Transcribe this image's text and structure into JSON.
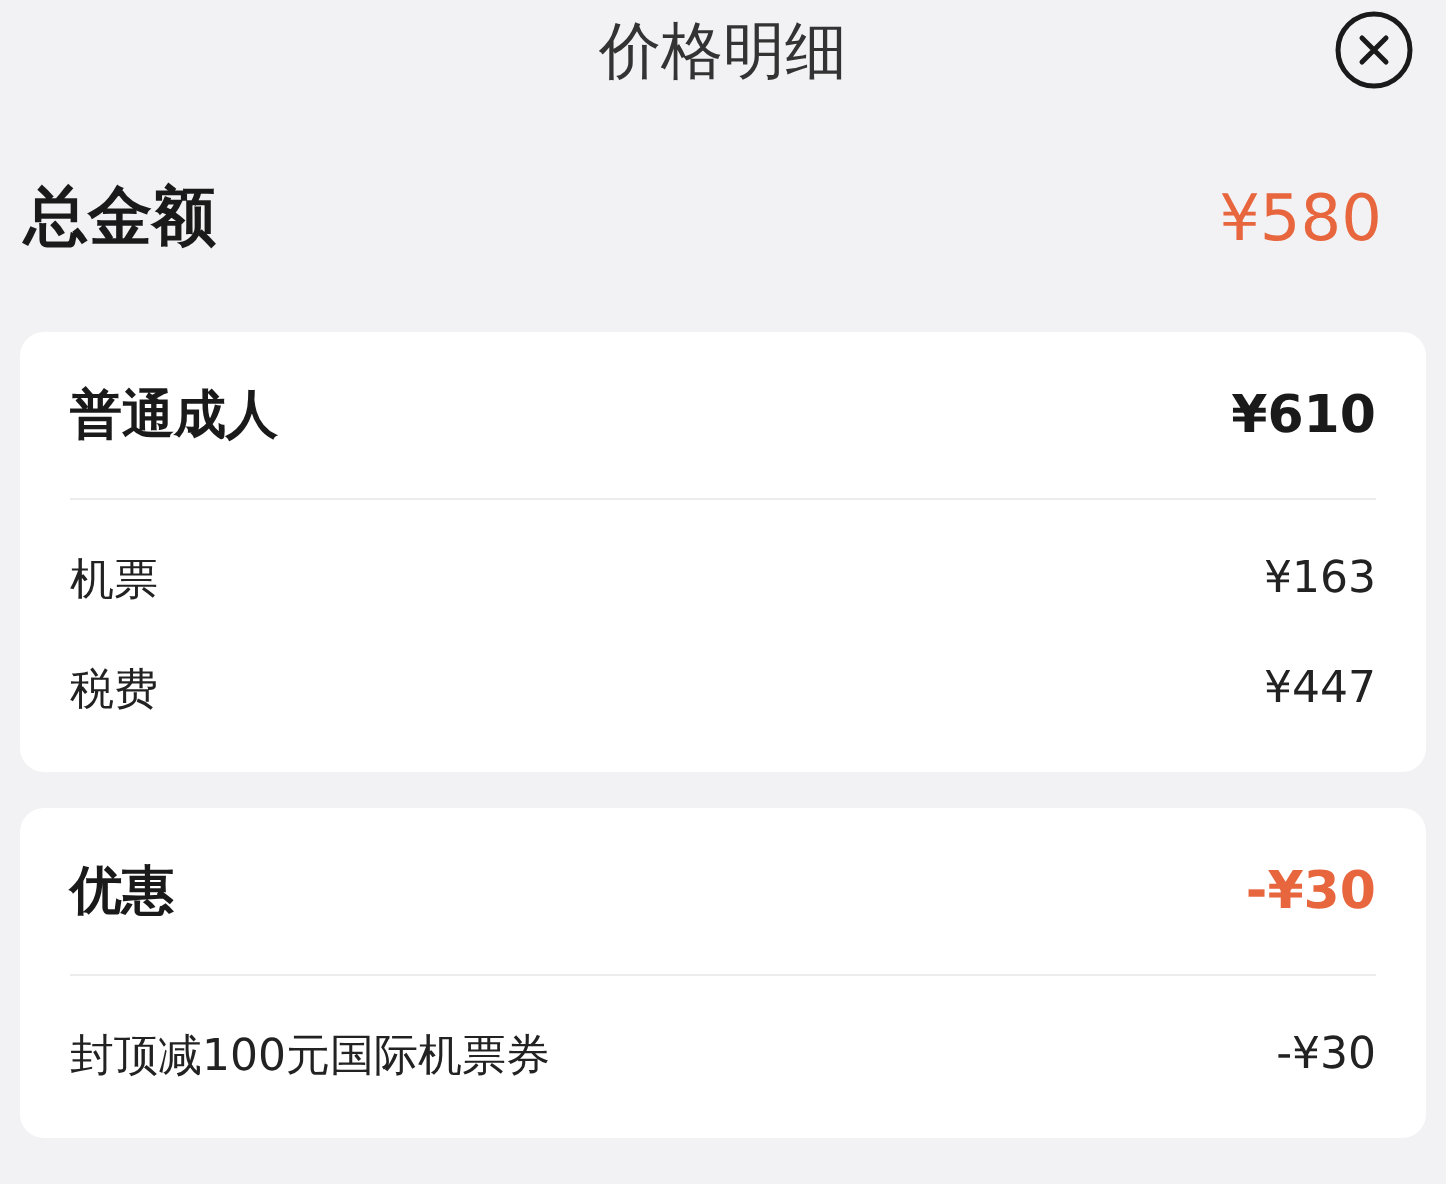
{
  "title": "价格明细",
  "total": {
    "label": "总金额",
    "amount": "¥580"
  },
  "sections": [
    {
      "label": "普通成人",
      "amount": "¥610",
      "highlight": false,
      "items": [
        {
          "label": "机票",
          "amount": "¥163"
        },
        {
          "label": "税费",
          "amount": "¥447"
        }
      ]
    },
    {
      "label": "优惠",
      "amount": "-¥30",
      "highlight": true,
      "items": [
        {
          "label": "封顶减100元国际机票券",
          "amount": "-¥30"
        }
      ]
    }
  ]
}
